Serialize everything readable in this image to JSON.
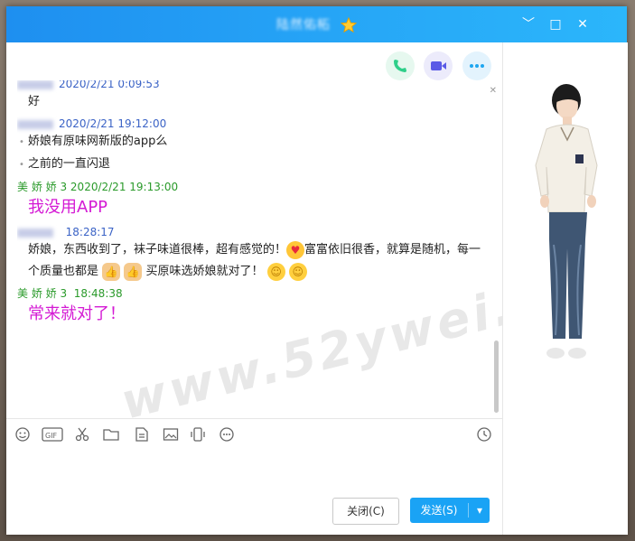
{
  "window": {
    "title": "陆然佑柘",
    "controls": {
      "min": "﹀",
      "max": "□",
      "close": "✕"
    }
  },
  "call_buttons": [
    {
      "name": "phone-icon",
      "glyph": "✆",
      "color": "#2fcf8a"
    },
    {
      "name": "video-icon",
      "glyph": "▶",
      "color": "#5a5ae6"
    },
    {
      "name": "more-icon",
      "glyph": "•••",
      "color": "#1ea7f0"
    }
  ],
  "messages": [
    {
      "sender": "",
      "time": "2020/2/21 0:09:53",
      "color": "blue",
      "lines": [
        "好"
      ]
    },
    {
      "sender": "",
      "time": "2020/2/21 19:12:00",
      "color": "blue",
      "bullets": [
        "娇娘有原味网新版的app么",
        "之前的一直闪退"
      ]
    },
    {
      "sender": "美 娇 娇 3",
      "time": "2020/2/21 19:13:00",
      "color": "green",
      "big": "我没用APP"
    },
    {
      "sender": "",
      "time": "18:28:17",
      "color": "blue",
      "text1": "娇娘，东西收到了，袜子味道很棒，超有感觉的！",
      "text2": "富富依旧很香，就算是随机，每一",
      "text3": "个质量也都是",
      "text4": "买原味选娇娘就对了！"
    },
    {
      "sender": "美 娇 娇 3",
      "time": "18:48:38",
      "color": "green",
      "big": "常来就对了！"
    }
  ],
  "watermark": "www.52ywei.net",
  "toolbar": [
    "emoji-icon",
    "gif-icon",
    "scissors-icon",
    "folder-icon",
    "doc-icon",
    "image-icon",
    "shake-icon",
    "more-icon",
    "history-icon"
  ],
  "buttons": {
    "close": "关闭(C)",
    "send": "发送(S)",
    "send_arrow": "▾"
  }
}
